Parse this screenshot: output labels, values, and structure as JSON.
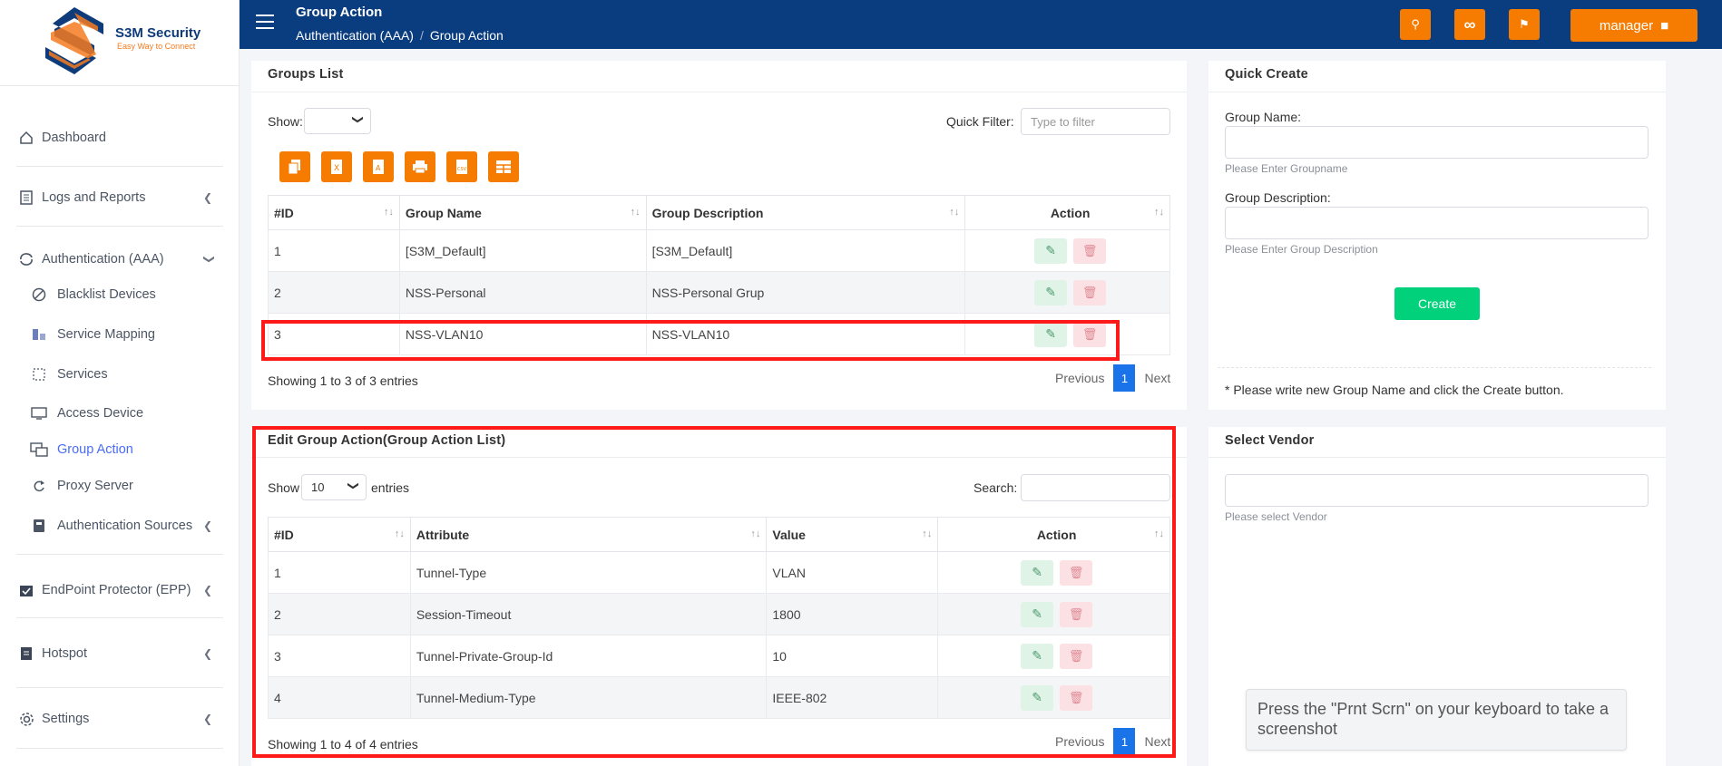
{
  "brand": {
    "name": "S3M Security",
    "tagline": "Easy Way to Connect"
  },
  "header": {
    "title": "Group Action",
    "breadcrumb": [
      "Authentication (AAA)",
      "Group Action"
    ],
    "user_button": "manager"
  },
  "sidebar": {
    "items": [
      {
        "label": "Dashboard",
        "icon": "home-icon"
      },
      {
        "label": "Logs and Reports",
        "icon": "report-icon"
      },
      {
        "label": "Authentication (AAA)",
        "icon": "sync-icon"
      },
      {
        "label": "Blacklist Devices",
        "icon": "ban-icon"
      },
      {
        "label": "Service Mapping",
        "icon": "mapping-icon"
      },
      {
        "label": "Services",
        "icon": "services-icon"
      },
      {
        "label": "Access Device",
        "icon": "monitor-icon"
      },
      {
        "label": "Group Action",
        "icon": "group-icon"
      },
      {
        "label": "Proxy Server",
        "icon": "redo-icon"
      },
      {
        "label": "Authentication Sources",
        "icon": "source-icon"
      },
      {
        "label": "EndPoint Protector (EPP)",
        "icon": "calendar-check-icon"
      },
      {
        "label": "Hotspot",
        "icon": "list-icon"
      },
      {
        "label": "Settings",
        "icon": "gear-icon"
      }
    ]
  },
  "groups_list": {
    "title": "Groups List",
    "show_label": "Show:",
    "show_value": "",
    "filter_label": "Quick Filter:",
    "filter_placeholder": "Type to filter",
    "columns": [
      "#ID",
      "Group Name",
      "Group Description",
      "Action"
    ],
    "rows": [
      {
        "id": "1",
        "name": "[S3M_Default]",
        "desc": "[S3M_Default]"
      },
      {
        "id": "2",
        "name": "NSS-Personal",
        "desc": "NSS-Personal Grup"
      },
      {
        "id": "3",
        "name": "NSS-VLAN10",
        "desc": "NSS-VLAN10"
      }
    ],
    "showing": "Showing 1 to 3 of 3 entries",
    "pager": {
      "prev": "Previous",
      "page": "1",
      "next": "Next"
    }
  },
  "edit_group_action": {
    "title": "Edit Group Action(Group Action List)",
    "show_label": "Show",
    "show_value": "10",
    "entries_label": "entries",
    "search_label": "Search:",
    "columns": [
      "#ID",
      "Attribute",
      "Value",
      "Action"
    ],
    "rows": [
      {
        "id": "1",
        "attribute": "Tunnel-Type",
        "value": "VLAN"
      },
      {
        "id": "2",
        "attribute": "Session-Timeout",
        "value": "1800"
      },
      {
        "id": "3",
        "attribute": "Tunnel-Private-Group-Id",
        "value": "10"
      },
      {
        "id": "4",
        "attribute": "Tunnel-Medium-Type",
        "value": "IEEE-802"
      }
    ],
    "showing": "Showing 1 to 4 of 4 entries",
    "pager": {
      "prev": "Previous",
      "page": "1",
      "next": "Next"
    }
  },
  "quick_create": {
    "title": "Quick Create",
    "name_label": "Group Name:",
    "name_hint": "Please Enter Groupname",
    "desc_label": "Group Description:",
    "desc_hint": "Please Enter Group Description",
    "create_label": "Create",
    "note": "* Please write new Group Name and click the Create button."
  },
  "select_vendor": {
    "title": "Select Vendor",
    "hint": "Please select Vendor"
  },
  "toast": "Press the \"Prnt Scrn\" on your keyboard to take a screenshot",
  "colors": {
    "header": "#0a3d7f",
    "accent": "#f57c00",
    "create": "#00d17a",
    "highlight": "#ff1a1a",
    "active_nav": "#4a6cf7"
  }
}
